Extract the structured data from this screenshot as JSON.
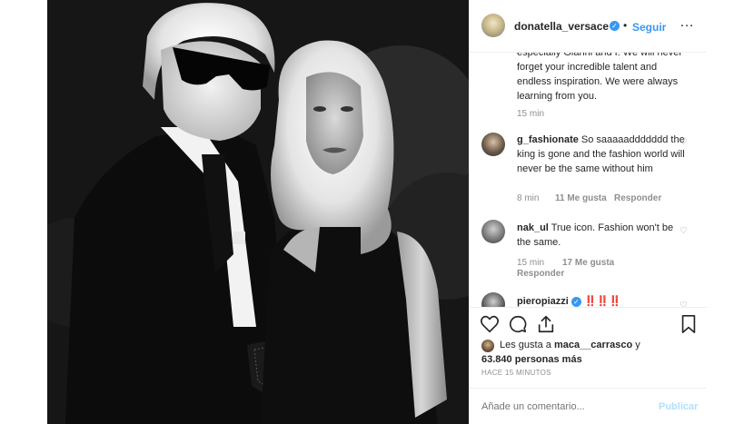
{
  "post": {
    "username": "donatella_versace",
    "follow_label": "Seguir",
    "separator": "•",
    "more_icon": "…"
  },
  "comments": [
    {
      "text": "especially Gianni and I. We will never forget your incredible talent and endless inspiration. We were always learning from you.",
      "time": "15 min"
    },
    {
      "username": "g_fashionate",
      "text": "So saaaaaddddddd the king is gone and the fashion world will never be the same without him",
      "time": "8 min",
      "likes": "11 Me gusta",
      "reply": "Responder"
    },
    {
      "username": "nak_ul",
      "text": "True icon. Fashion won't be the same.",
      "time": "15 min",
      "likes": "17 Me gusta",
      "reply": "Responder"
    },
    {
      "username": "pieropiazzi",
      "text": "‼️‼️‼️"
    }
  ],
  "likes": {
    "prefix": "Les gusta a",
    "user": "maca__carrasco",
    "connector": "y",
    "count": "63.840 personas más"
  },
  "time_ago": "HACE 15 MINUTOS",
  "add_comment": {
    "placeholder": "Añade un comentario...",
    "publish_label": "Publicar"
  },
  "colors": {
    "accent": "#3897f0",
    "text": "#262626",
    "muted": "#8e8e8e"
  }
}
